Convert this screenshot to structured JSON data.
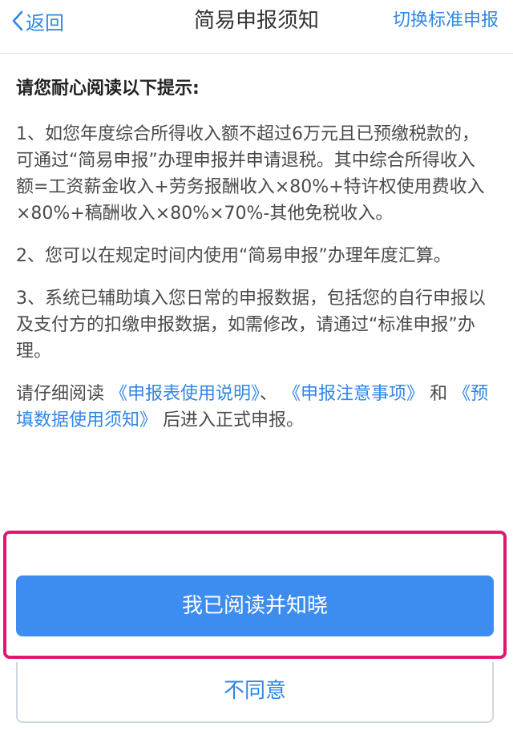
{
  "header": {
    "back_label": "返回",
    "title": "简易申报须知",
    "switch_label": "切换标准申报"
  },
  "content": {
    "intro": "请您耐心阅读以下提示:",
    "paragraphs": [
      "1、如您年度综合所得收入额不超过6万元且已预缴税款的，可通过“简易申报”办理申报并申请退税。其中综合所得收入额=工资薪金收入+劳务报酬收入×80%+特许权使用费收入×80%+稿酬收入×80%×70%-其他免税收入。",
      "2、您可以在规定时间内使用“简易申报”办理年度汇算。",
      "3、系统已辅助填入您日常的申报数据，包括您的自行申报以及支付方的扣缴申报数据，如需修改，请通过“标准申报”办理。"
    ],
    "notice": {
      "prefix": "请仔细阅读",
      "link1": "《申报表使用说明》",
      "sep": "、",
      "link2": "《申报注意事项》",
      "and": "和",
      "link3": "《预填数据使用须知》",
      "suffix": "后进入正式申报。"
    }
  },
  "actions": {
    "confirm_label": "我已阅读并知晓",
    "decline_label": "不同意"
  },
  "colors": {
    "accent": "#2f86e8",
    "primary_button": "#3d8cf0",
    "highlight_border": "#e2166f"
  }
}
